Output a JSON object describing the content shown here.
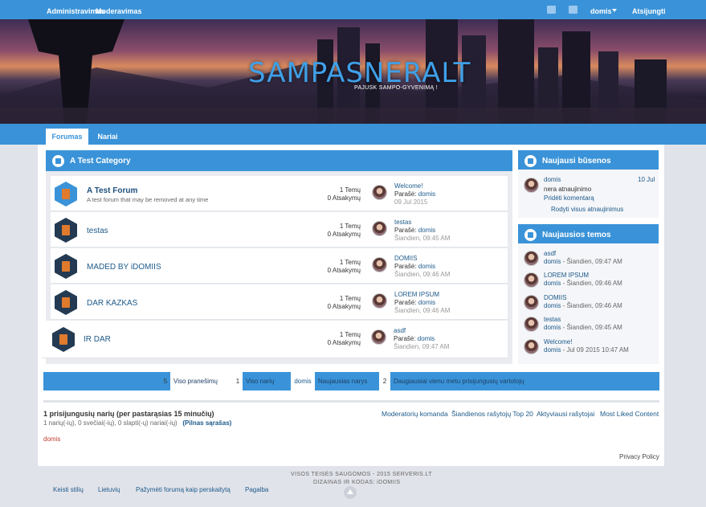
{
  "topbar": {
    "admin": "Administravimas",
    "moderation": "Moderavimas",
    "user": "domis",
    "logout": "Atsijungti"
  },
  "banner": {
    "title": "SAMPASNERALT",
    "subtitle": "PAJUSK SAMPO-GYVENIMĄ !"
  },
  "nav": {
    "tabs": [
      {
        "label": "Forumas"
      },
      {
        "label": "Nariai"
      }
    ]
  },
  "category": {
    "title": "A Test Category",
    "forums": [
      {
        "name": "A Test Forum",
        "desc": "A test forum that may be removed at any time",
        "topics": "1 Temų",
        "replies": "0 Atsakymų",
        "last_title": "Welcome!",
        "last_by": "Parašė: ",
        "last_user": "domis",
        "last_date": "09 Jul 2015"
      },
      {
        "name": "testas",
        "desc": "",
        "topics": "1 Temų",
        "replies": "0 Atsakymų",
        "last_title": "testas",
        "last_by": "Parašė: ",
        "last_user": "domis",
        "last_date": "Šiandien, 09:45 AM"
      },
      {
        "name": "MADED BY iDOMIIS",
        "desc": "",
        "topics": "1 Temų",
        "replies": "0 Atsakymų",
        "last_title": "DOMIIS",
        "last_by": "Parašė: ",
        "last_user": "domis",
        "last_date": "Šiandien, 09:46 AM"
      },
      {
        "name": "DAR KAZKAS",
        "desc": "",
        "topics": "1 Temų",
        "replies": "0 Atsakymų",
        "last_title": "LOREM IPSUM",
        "last_by": "Parašė: ",
        "last_user": "domis",
        "last_date": "Šiandien, 09:46 AM"
      },
      {
        "name": "IR DAR",
        "desc": "",
        "topics": "1 Temų",
        "replies": "0 Atsakymų",
        "last_title": "asdf",
        "last_by": "Parašė: ",
        "last_user": "domis",
        "last_date": "Šiandien, 09:47 AM"
      }
    ]
  },
  "status": {
    "title": "Naujausi būsenos",
    "user": "domis",
    "date": "10 Jul",
    "text": "nera atnaujinimo",
    "comment": "Pridėti komentarą",
    "view_all": "Rodyti visus atnaujinimus"
  },
  "topics": {
    "title": "Naujausios temos",
    "items": [
      {
        "title": "asdf",
        "user": "domis",
        "date": " - Šiandien, 09:47 AM"
      },
      {
        "title": "LOREM IPSUM",
        "user": "domis",
        "date": " - Šiandien, 09:46 AM"
      },
      {
        "title": "DOMIIS",
        "user": "domis",
        "date": " - Šiandien, 09:46 AM"
      },
      {
        "title": "testas",
        "user": "domis",
        "date": " - Šiandien, 09:45 AM"
      },
      {
        "title": "Welcome!",
        "user": "domis",
        "date": " - Jul 09 2015 10:47 AM"
      }
    ]
  },
  "stats": {
    "posts_num": "5",
    "posts_label": "Viso pranešimų",
    "members_num": "1",
    "members_label": "Viso narių",
    "newest_user": "domis",
    "newest_label": "Naujausias narys",
    "online_num": "2",
    "online_label": "Daugiausiai vienu metu prisijungusių vartotojų"
  },
  "online": {
    "title": "1 prisijungusių narių (per pastarąsias 15 minučių)",
    "detail": "1 narių(-ių), 0 svečiai(-ių), 0 slapti(-ų) nariai(-ių)",
    "full_list": "(Pilnas sąrašas)",
    "user": "domis",
    "links": [
      "Moderatorių komanda",
      "Šiandienos rašytojų Top 20",
      "Aktyviausi rašytojai",
      "Most Liked Content"
    ]
  },
  "privacy": "Privacy Policy",
  "footer": {
    "copyright": "VISOS TEISĖS SAUGOMOS - 2015 SERVERIS.LT",
    "design": "DIZAINAS IR KODAS: iDOMIIS",
    "links": [
      "Keisti stilių",
      "Lietuvių",
      "Pažymėti forumą kaip perskaitytą",
      "Pagalba"
    ]
  },
  "colors": {
    "accent": "#3a93d8",
    "link": "#1d5a8a",
    "online_user": "#c0392b"
  }
}
